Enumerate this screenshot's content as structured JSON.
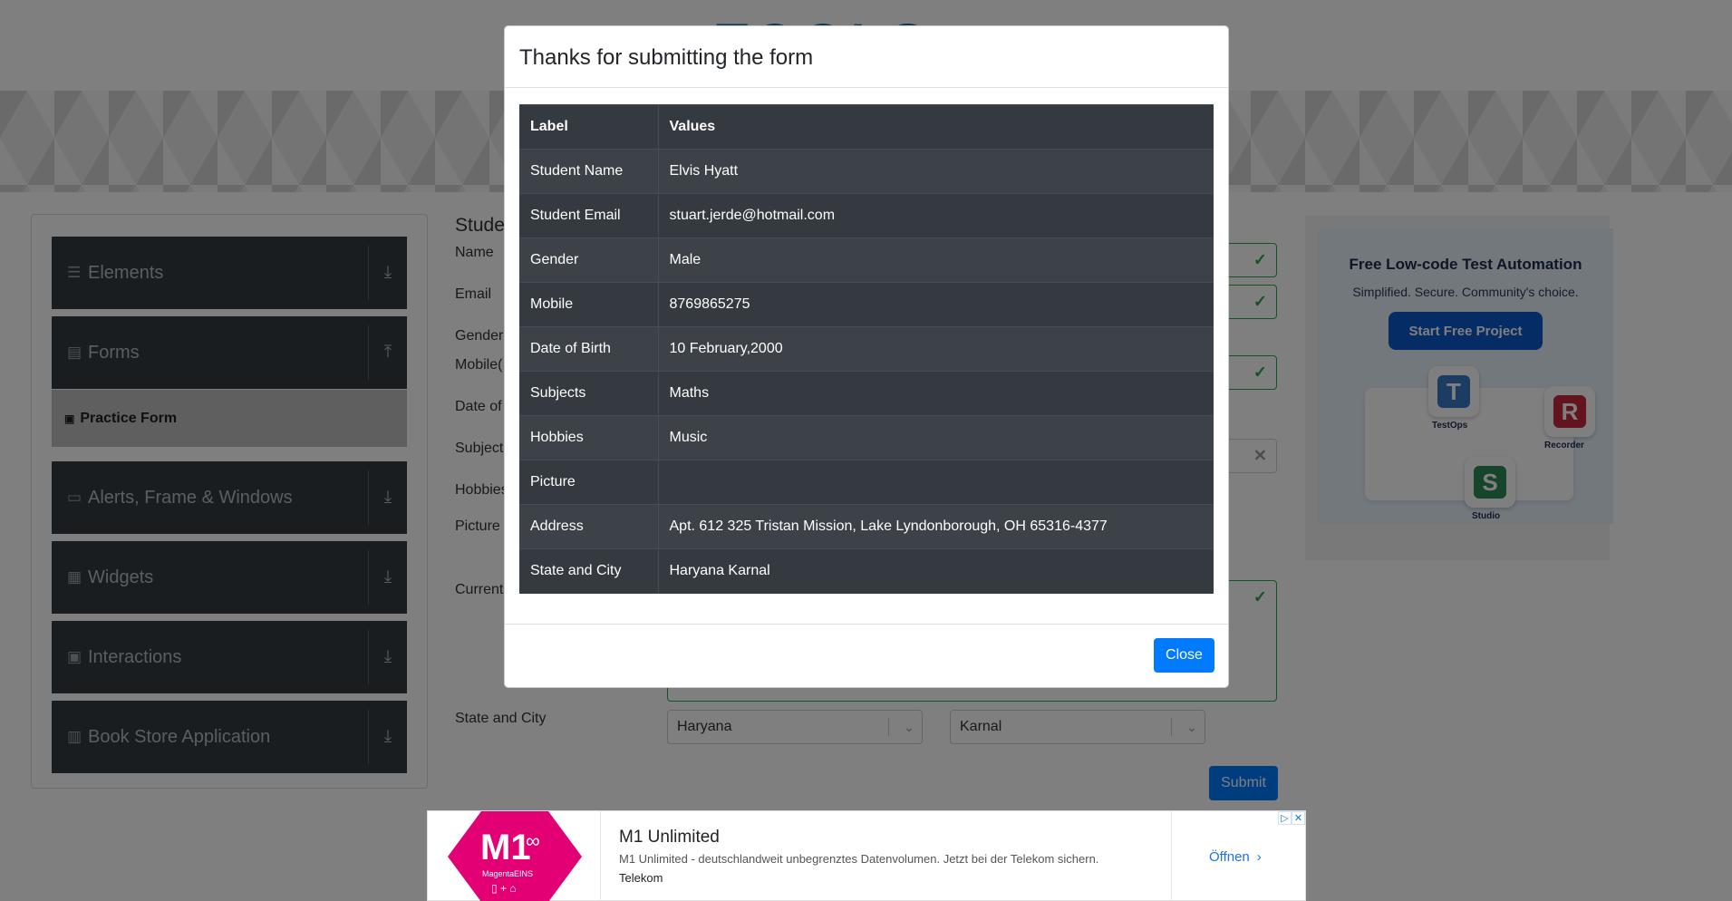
{
  "header": {
    "logo_text": "TOOLS"
  },
  "sidebar": {
    "groups": [
      {
        "label": "Elements",
        "icon": "hamburger-icon",
        "arrow": "download-arrow-icon"
      },
      {
        "label": "Forms",
        "icon": "document-icon",
        "arrow": "upload-arrow-icon"
      },
      {
        "label": "Alerts, Frame & Windows",
        "icon": "window-icon",
        "arrow": "download-arrow-icon"
      },
      {
        "label": "Widgets",
        "icon": "grid-icon",
        "arrow": "download-arrow-icon"
      },
      {
        "label": "Interactions",
        "icon": "square-icon",
        "arrow": "download-arrow-icon"
      },
      {
        "label": "Book Store Application",
        "icon": "books-icon",
        "arrow": "download-arrow-icon"
      }
    ],
    "active_item": {
      "label": "Practice Form",
      "icon": "clipboard-icon"
    }
  },
  "form": {
    "title": "Studen",
    "labels": {
      "name": "Name",
      "email": "Email",
      "gender": "Gender",
      "mobile": "Mobile(",
      "dob": "Date of",
      "subjects": "Subject",
      "hobbies": "Hobbies",
      "picture": "Picture",
      "address": "Current",
      "state_city": "State and City"
    },
    "state_value": "Haryana",
    "city_value": "Karnal",
    "submit_label": "Submit"
  },
  "right_ad": {
    "headline": "Free Low-code Test Automation",
    "subline": "Simplified. Secure. Community's choice.",
    "button": "Start Free Project",
    "tiles": [
      "TestOps",
      "Recorder",
      "Studio"
    ]
  },
  "bottom_ad": {
    "title": "M1 Unlimited",
    "description": "M1 Unlimited - deutschlandweit unbegrenztes Datenvolumen. Jetzt bei der Telekom sichern.",
    "brand": "Telekom",
    "open_label": "Öffnen",
    "logo_main": "M1",
    "logo_sub": "MagentaEINS",
    "logo_icons": "▯ + ⌂"
  },
  "modal": {
    "title": "Thanks for submitting the form",
    "columns": [
      "Label",
      "Values"
    ],
    "rows": [
      {
        "label": "Student Name",
        "value": "Elvis Hyatt"
      },
      {
        "label": "Student Email",
        "value": "stuart.jerde@hotmail.com"
      },
      {
        "label": "Gender",
        "value": "Male"
      },
      {
        "label": "Mobile",
        "value": "8769865275"
      },
      {
        "label": "Date of Birth",
        "value": "10 February,2000"
      },
      {
        "label": "Subjects",
        "value": "Maths"
      },
      {
        "label": "Hobbies",
        "value": "Music"
      },
      {
        "label": "Picture",
        "value": ""
      },
      {
        "label": "Address",
        "value": "Apt. 612 325 Tristan Mission, Lake Lyndonborough, OH 65316-4377"
      },
      {
        "label": "State and City",
        "value": "Haryana Karnal"
      }
    ],
    "close_label": "Close"
  },
  "colors": {
    "primary": "#007bff",
    "sidebar": "#343a40",
    "success": "#28a745",
    "magenta": "#e20074"
  }
}
